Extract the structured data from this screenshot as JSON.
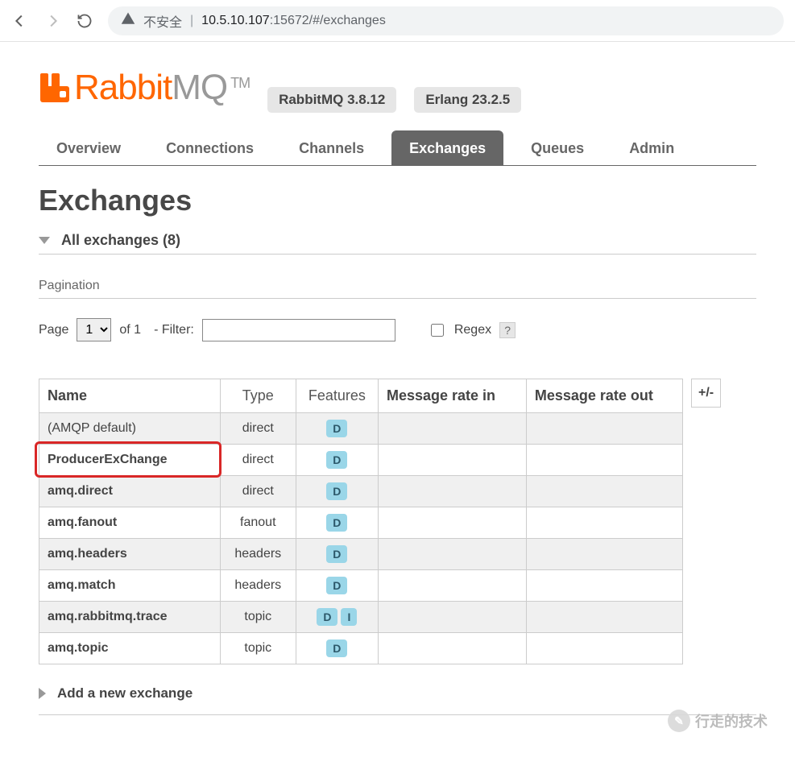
{
  "browser": {
    "insecure_label": "不安全",
    "url_host": "10.5.10.107",
    "url_port": ":15672",
    "url_path": "/#/exchanges"
  },
  "header": {
    "logo_rabbit": "Rabbit",
    "logo_mq": "MQ",
    "tm": "TM",
    "version_pill": "RabbitMQ 3.8.12",
    "erlang_pill": "Erlang 23.2.5"
  },
  "tabs": [
    {
      "label": "Overview",
      "active": false
    },
    {
      "label": "Connections",
      "active": false
    },
    {
      "label": "Channels",
      "active": false
    },
    {
      "label": "Exchanges",
      "active": true
    },
    {
      "label": "Queues",
      "active": false
    },
    {
      "label": "Admin",
      "active": false
    }
  ],
  "page_title": "Exchanges",
  "section_all": "All exchanges (8)",
  "pagination_label": "Pagination",
  "filter": {
    "page_label": "Page",
    "page_value": "1",
    "of_label": "of 1",
    "filter_label": "- Filter:",
    "filter_value": "",
    "regex_label": "Regex",
    "help": "?"
  },
  "table": {
    "headers": {
      "name": "Name",
      "type": "Type",
      "features": "Features",
      "rate_in": "Message rate in",
      "rate_out": "Message rate out"
    },
    "plusminus": "+/-",
    "rows": [
      {
        "name": "(AMQP default)",
        "bold": false,
        "type": "direct",
        "features": [
          "D"
        ]
      },
      {
        "name": "ProducerExChange",
        "bold": true,
        "type": "direct",
        "features": [
          "D"
        ],
        "highlight": true
      },
      {
        "name": "amq.direct",
        "bold": true,
        "type": "direct",
        "features": [
          "D"
        ]
      },
      {
        "name": "amq.fanout",
        "bold": true,
        "type": "fanout",
        "features": [
          "D"
        ]
      },
      {
        "name": "amq.headers",
        "bold": true,
        "type": "headers",
        "features": [
          "D"
        ]
      },
      {
        "name": "amq.match",
        "bold": true,
        "type": "headers",
        "features": [
          "D"
        ]
      },
      {
        "name": "amq.rabbitmq.trace",
        "bold": true,
        "type": "topic",
        "features": [
          "D",
          "I"
        ]
      },
      {
        "name": "amq.topic",
        "bold": true,
        "type": "topic",
        "features": [
          "D"
        ]
      }
    ]
  },
  "add_new": "Add a new exchange",
  "watermark": "行走的技术"
}
